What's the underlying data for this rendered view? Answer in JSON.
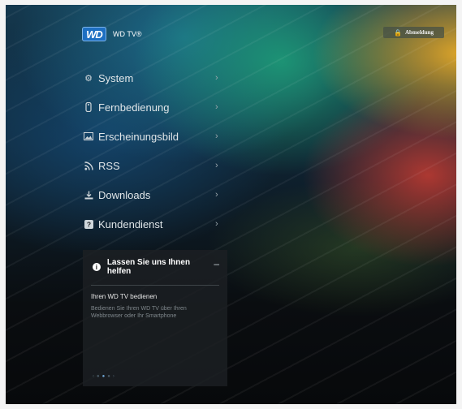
{
  "brand": {
    "logo_text": "WD",
    "product": "WD TV®"
  },
  "header": {
    "logout_label": "Abmeldung",
    "logout_icon": "lock-icon"
  },
  "menu": [
    {
      "label": "System",
      "icon": "gear-icon"
    },
    {
      "label": "Fernbedienung",
      "icon": "remote-icon"
    },
    {
      "label": "Erscheinungsbild",
      "icon": "image-icon"
    },
    {
      "label": "RSS",
      "icon": "rss-icon"
    },
    {
      "label": "Downloads",
      "icon": "download-icon"
    },
    {
      "label": "Kundendienst",
      "icon": "help-icon"
    }
  ],
  "help_card": {
    "title": "Lassen Sie uns Ihnen helfen",
    "subtitle": "Ihren WD TV bedienen",
    "description": "Bedienen Sie Ihren WD TV über Ihren Webbrowser oder Ihr Smartphone",
    "active_page": 3,
    "page_count": 5
  }
}
